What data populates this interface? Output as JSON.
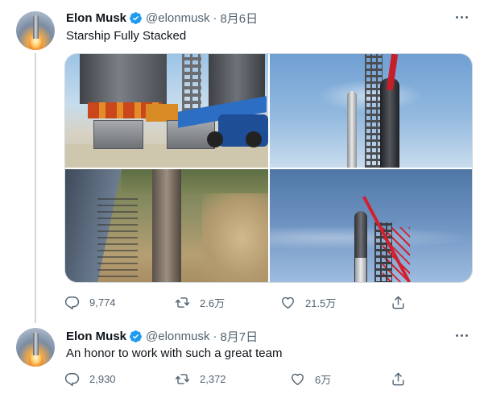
{
  "tweets": [
    {
      "author_name": "Elon Musk",
      "handle": "@elonmusk",
      "separator": "·",
      "date": "8月6日",
      "text": "Starship Fully Stacked",
      "stats": {
        "replies": "9,774",
        "retweets": "2.6万",
        "likes": "21.5万"
      },
      "media_count": 4
    },
    {
      "author_name": "Elon Musk",
      "handle": "@elonmusk",
      "separator": "·",
      "date": "8月7日",
      "text": "An honor to work with such a great team",
      "stats": {
        "replies": "2,930",
        "retweets": "2,372",
        "likes": "6万"
      }
    }
  ],
  "icons": {
    "verified": "verified-badge-icon",
    "more": "more-horizontal-icon",
    "reply": "reply-icon",
    "retweet": "retweet-icon",
    "like": "heart-icon",
    "share": "share-icon"
  },
  "colors": {
    "verified_blue": "#1d9bf0",
    "secondary_text": "#536471",
    "primary_text": "#0f1419",
    "divider": "#cfd9de"
  }
}
